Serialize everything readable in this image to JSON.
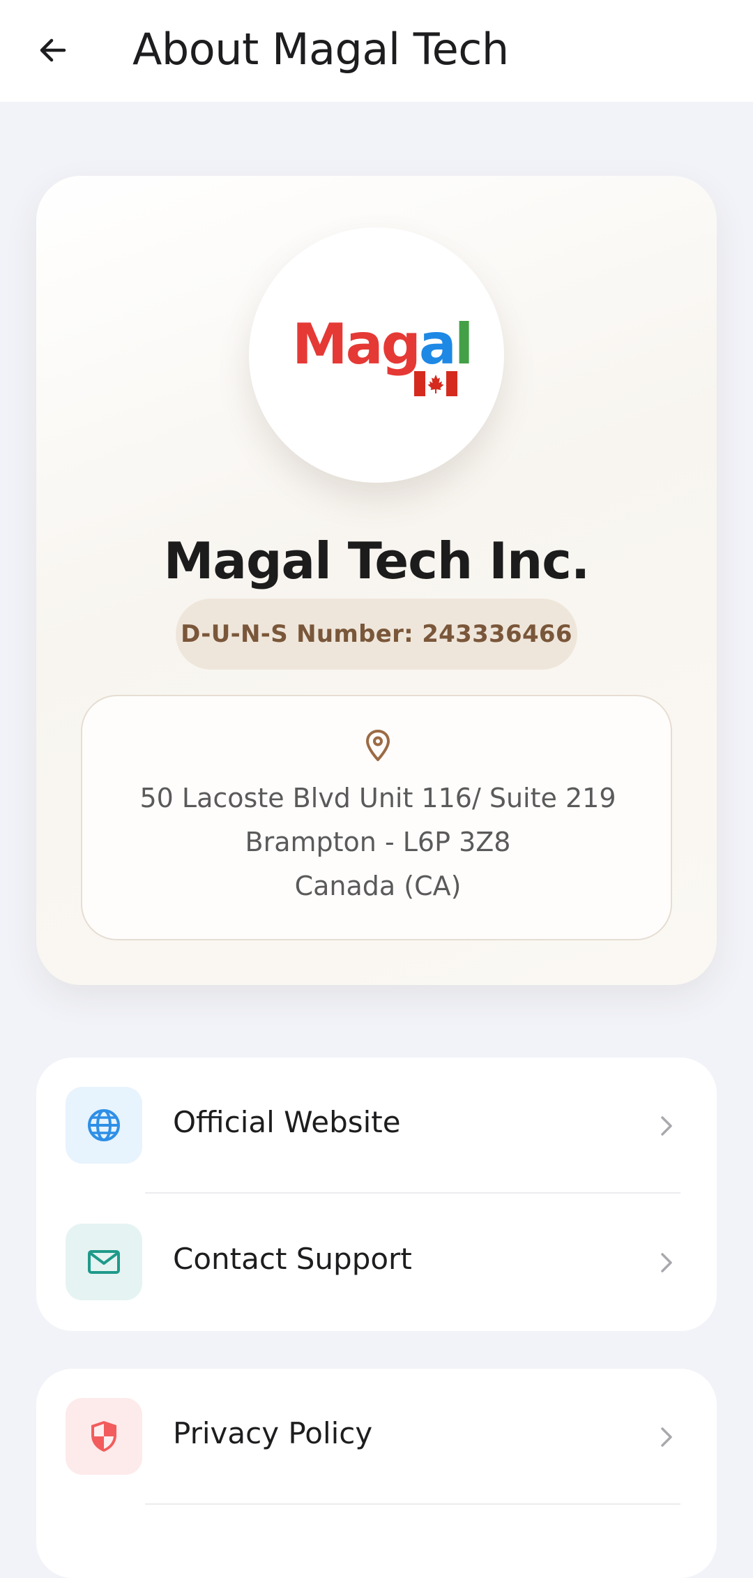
{
  "app_bar": {
    "title": "About Magal Tech"
  },
  "profile": {
    "logo_text": {
      "letters": [
        {
          "char": "M",
          "color": "#e53935"
        },
        {
          "char": "a",
          "color": "#e53935"
        },
        {
          "char": "g",
          "color": "#e53935"
        },
        {
          "char": "a",
          "color": "#1e88e5"
        },
        {
          "char": "l",
          "color": "#43a047"
        }
      ]
    },
    "company_name": "Magal Tech Inc.",
    "duns": "D-U-N-S Number: 243336466",
    "address": {
      "line1": "50 Lacoste Blvd Unit 116/ Suite 219",
      "line2": "Brampton - L6P 3Z8",
      "line3": "Canada (CA)"
    }
  },
  "links": {
    "official_website": {
      "label": "Official Website",
      "icon": "globe-icon",
      "color": "#2e8fe6",
      "bg": "#e7f3fd"
    },
    "contact_support": {
      "label": "Contact Support",
      "icon": "mail-icon",
      "color": "#1f9a8a",
      "bg": "#e5f4f2"
    },
    "privacy_policy": {
      "label": "Privacy Policy",
      "icon": "shield-icon",
      "color": "#f25c5c",
      "bg": "#fdeaea"
    }
  },
  "colors": {
    "background": "#f2f3f8",
    "accent_brown": "#7a573a",
    "pin": "#9b6b45"
  }
}
